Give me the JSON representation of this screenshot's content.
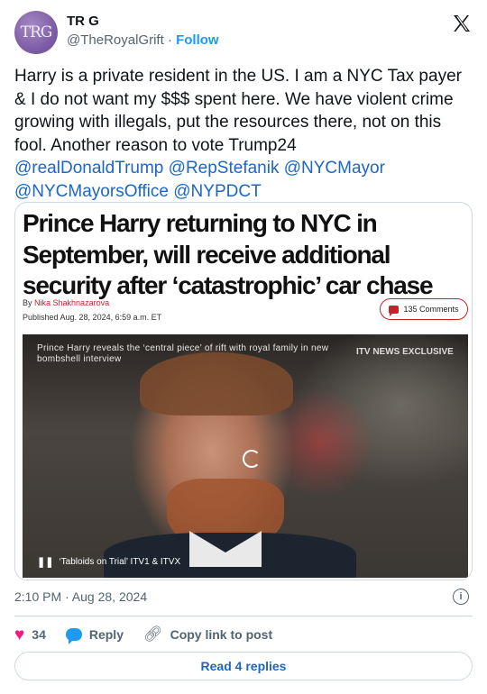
{
  "author": {
    "avatar_text": "TRG",
    "name": "TR G",
    "handle": "@TheRoyalGrift",
    "separator": "·",
    "follow_label": "Follow"
  },
  "tweet": {
    "text": "Harry is a private resident in the US. I am a NYC Tax payer & I do not want my $$$ spent here. We have violent crime growing with illegals, put the resources there, not on this fool. Another reason to vote Trump24",
    "mentions": [
      "@realDonaldTrump",
      "@RepStefanik",
      "@NYCMayor",
      "@NYCMayorsOffice",
      "@NYPDCT"
    ]
  },
  "card": {
    "headline": "Prince Harry returning to NYC in September, will receive additional security after ‘catastrophic’ car chase",
    "by_prefix": "By",
    "author": "Nika Shakhnazarova",
    "published": "Published Aug. 28, 2024, 6:59 a.m. ET",
    "comments_label": "135 Comments",
    "video_caption": "Prince Harry reveals the ‘central piece’ of rift with royal family in new bombshell interview",
    "video_brand": "ITV NEWS EXCLUSIVE",
    "video_controls_text": "‘Tabloids on Trial’ ITV1 & ITVX"
  },
  "meta": {
    "timestamp": "2:10 PM · Aug 28, 2024"
  },
  "actions": {
    "like_count": "34",
    "reply_label": "Reply",
    "copy_label": "Copy link to post"
  },
  "replies_button": "Read 4 replies",
  "colors": {
    "link_blue": "#1d9bf0",
    "mention_blue": "#1d66c4",
    "heart_pink": "#f91880",
    "post_red": "#c4232b"
  }
}
